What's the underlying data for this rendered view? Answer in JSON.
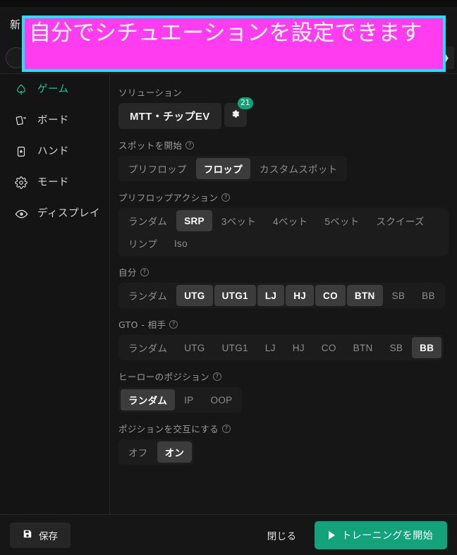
{
  "window": {
    "title": "新",
    "chevron_icon": "chevron-right-icon"
  },
  "annotation": {
    "text": "自分でシチュエーションを設定できます",
    "fill_color": "#ff3cf0",
    "border_color": "#1ce4f5",
    "text_color": "#ffffff"
  },
  "sidebar": {
    "items": [
      {
        "label": "ゲーム",
        "icon": "spade-icon",
        "active": true
      },
      {
        "label": "ボード",
        "icon": "cards-icon",
        "active": false
      },
      {
        "label": "ハンド",
        "icon": "card-spade-icon",
        "active": false
      },
      {
        "label": "モード",
        "icon": "gear-icon",
        "active": false
      },
      {
        "label": "ディスプレイ",
        "icon": "eye-icon",
        "active": false
      }
    ],
    "active_color": "#18c79b"
  },
  "main": {
    "solution": {
      "label": "ソリューション",
      "value": "MTT・チップEV",
      "gear_icon": "gear-icon",
      "badge": "21",
      "badge_color": "#13a176"
    },
    "start_spot": {
      "label": "スポットを開始",
      "help_icon": "help-circle-icon",
      "options": [
        {
          "label": "プリフロップ",
          "selected": false
        },
        {
          "label": "フロップ",
          "selected": true
        },
        {
          "label": "カスタムスポット",
          "selected": false
        }
      ]
    },
    "preflop_action": {
      "label": "プリフロップアクション",
      "help_icon": "help-circle-icon",
      "options": [
        {
          "label": "ランダム",
          "selected": false
        },
        {
          "label": "SRP",
          "selected": true
        },
        {
          "label": "3ベット",
          "selected": false
        },
        {
          "label": "4ベット",
          "selected": false
        },
        {
          "label": "5ベット",
          "selected": false
        },
        {
          "label": "スクイーズ",
          "selected": false
        },
        {
          "label": "リンプ",
          "selected": false
        },
        {
          "label": "Iso",
          "selected": false
        }
      ]
    },
    "hero_positions": {
      "label": "自分",
      "help_icon": "help-circle-icon",
      "options": [
        {
          "label": "ランダム",
          "selected": false
        },
        {
          "label": "UTG",
          "selected": true
        },
        {
          "label": "UTG1",
          "selected": true
        },
        {
          "label": "LJ",
          "selected": true
        },
        {
          "label": "HJ",
          "selected": true
        },
        {
          "label": "CO",
          "selected": true
        },
        {
          "label": "BTN",
          "selected": true
        },
        {
          "label": "SB",
          "selected": false
        },
        {
          "label": "BB",
          "selected": false
        }
      ]
    },
    "gto_opponent": {
      "label": "GTO - 相手",
      "help_icon": "help-circle-icon",
      "options": [
        {
          "label": "ランダム",
          "selected": false
        },
        {
          "label": "UTG",
          "selected": false
        },
        {
          "label": "UTG1",
          "selected": false
        },
        {
          "label": "LJ",
          "selected": false
        },
        {
          "label": "HJ",
          "selected": false
        },
        {
          "label": "CO",
          "selected": false
        },
        {
          "label": "BTN",
          "selected": false
        },
        {
          "label": "SB",
          "selected": false
        },
        {
          "label": "BB",
          "selected": true
        }
      ]
    },
    "hero_position_type": {
      "label": "ヒーローのポジション",
      "help_icon": "help-circle-icon",
      "options": [
        {
          "label": "ランダム",
          "selected": true
        },
        {
          "label": "IP",
          "selected": false
        },
        {
          "label": "OOP",
          "selected": false
        }
      ]
    },
    "alternate_positions": {
      "label": "ポジションを交互にする",
      "help_icon": "help-circle-icon",
      "options": [
        {
          "label": "オフ",
          "selected": false
        },
        {
          "label": "オン",
          "selected": true
        }
      ]
    }
  },
  "footer": {
    "save_label": "保存",
    "save_icon": "save-disk-icon",
    "close_label": "閉じる",
    "start_label": "トレーニングを開始",
    "start_icon": "play-icon",
    "start_color": "#12a37b"
  }
}
